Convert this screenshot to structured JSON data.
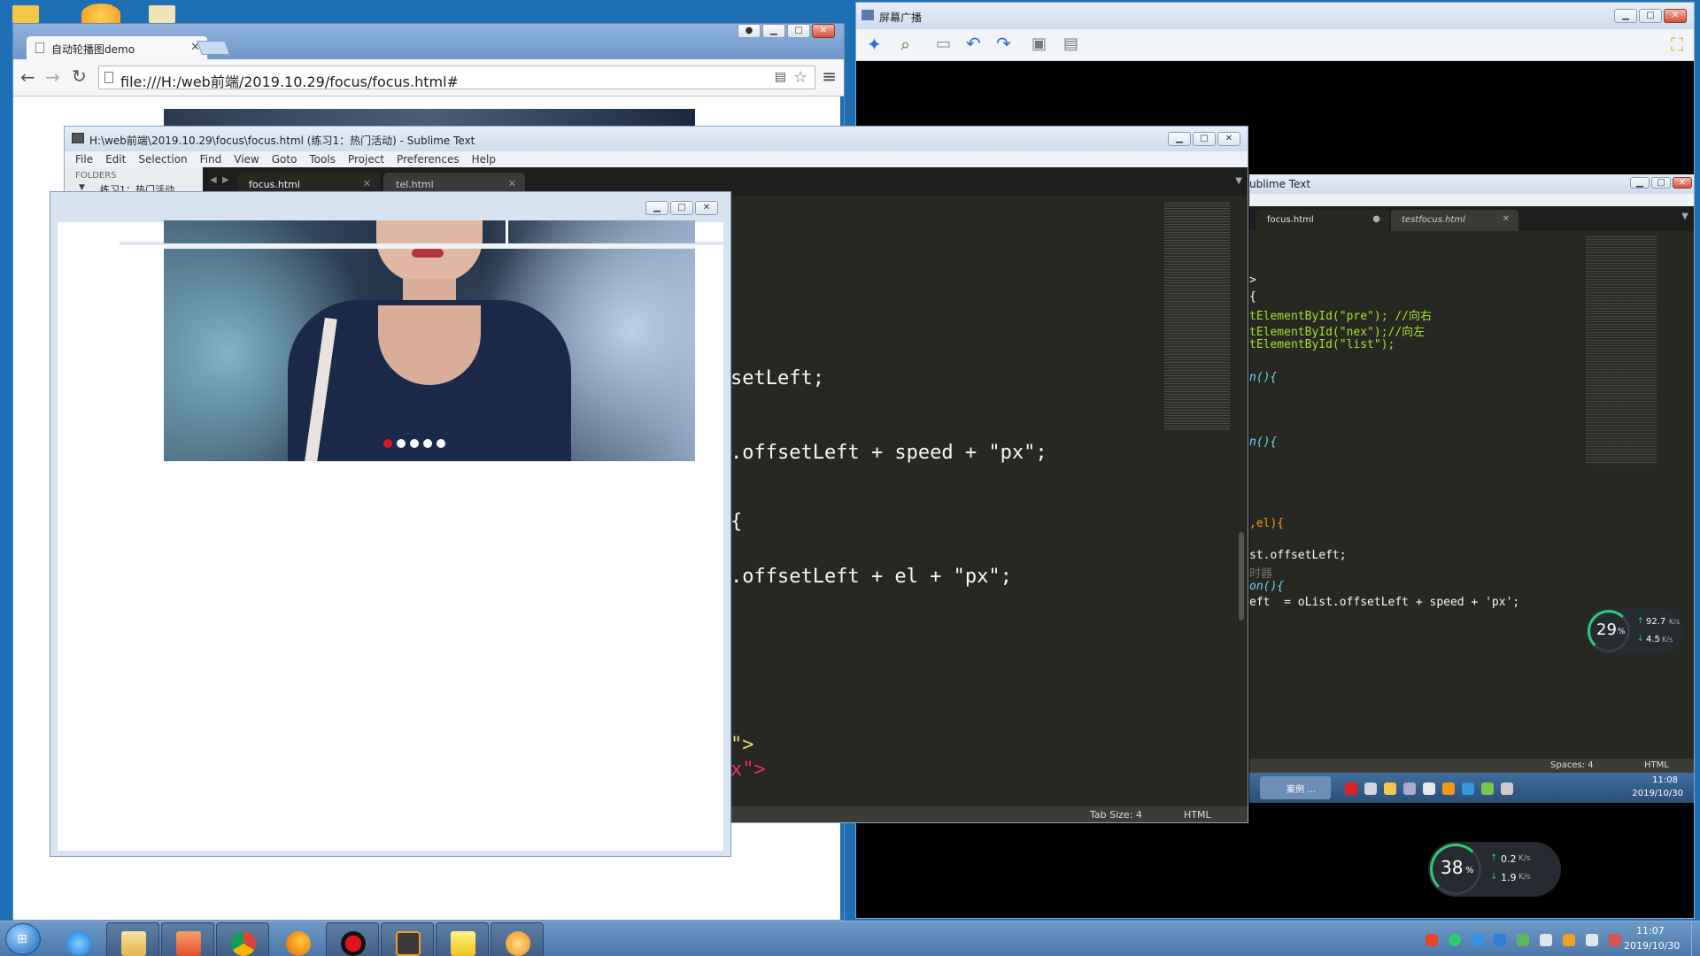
{
  "chrome": {
    "tab_title": "自动轮播图demo",
    "url": "file:///H:/web前端/2019.10.29/focus/focus.html#"
  },
  "broadcast": {
    "title": "屏幕广播",
    "inner_sublime_title": "ublime Text",
    "tabs": [
      {
        "label": "focus.html"
      },
      {
        "label": "testfocus.html"
      }
    ],
    "code_lines": [
      ">",
      "{",
      "tElementById(\"pre\"); //向右",
      "tElementById(\"nex\");//向左",
      "tElementById(\"list\");",
      "n(){",
      "n(){",
      ",el){",
      "st.offsetLeft;",
      "时器",
      "on(){",
      "eft  = oList.offsetLeft + speed + 'px';"
    ],
    "status_spaces": "Spaces: 4",
    "status_syntax": "HTML",
    "inner_taskbar_label": "案例 ...",
    "inner_clock_time": "11:08",
    "inner_clock_date": "2019/10/30"
  },
  "sublime": {
    "title": "H:\\web前端\\2019.10.29\\focus\\focus.html (练习1：热门活动) - Sublime Text",
    "menu": [
      "File",
      "Edit",
      "Selection",
      "Find",
      "View",
      "Goto",
      "Tools",
      "Project",
      "Preferences",
      "Help"
    ],
    "folders_label": "FOLDERS",
    "folder_item": "练习1：热门活动",
    "tabs": [
      {
        "label": "focus.html"
      },
      {
        "label": "tel.html"
      }
    ],
    "code_lines": [
      "setLeft;",
      ".offsetLeft + speed + \"px\";",
      "{",
      ".offsetLeft + el + \"px\";",
      "\">",
      "x\">"
    ],
    "status_tab_size": "Tab Size: 4",
    "status_syntax": "HTML"
  },
  "netmon_small": {
    "percent": "29",
    "unit": "%",
    "up": "92.7",
    "down": "4.5",
    "rate_unit": "K/s"
  },
  "netmon_large": {
    "percent": "38",
    "unit": "%",
    "up": "0.2",
    "down": "1.9",
    "rate_unit": "K/s"
  },
  "taskbar": {
    "clock_time": "11:07",
    "clock_date": "2019/10/30"
  },
  "carousel": {
    "dot_count": 5,
    "active_dot": 0,
    "active_color": "#e0121e"
  }
}
